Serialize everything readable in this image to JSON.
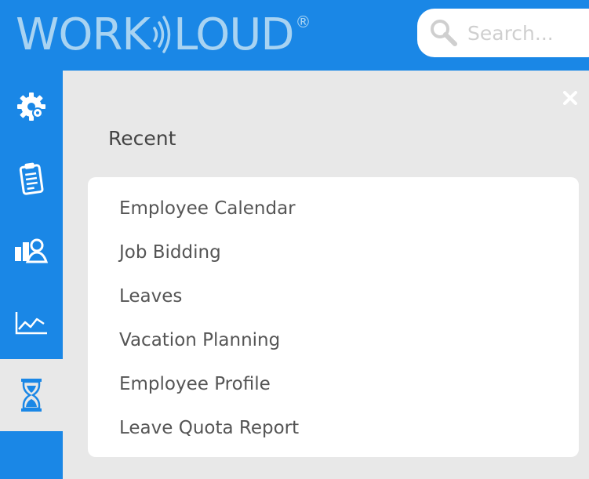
{
  "header": {
    "logo_text_left": "WORK",
    "logo_text_right": "LOUD",
    "logo_registered": "®",
    "logo_color": "#a8d3f2",
    "brand_color": "#1a87e6"
  },
  "search": {
    "placeholder": "Search...",
    "value": "",
    "icon": "search-icon"
  },
  "sidebar": {
    "items": [
      {
        "name": "settings",
        "icon": "gear-icon"
      },
      {
        "name": "clipboard",
        "icon": "clipboard-icon"
      },
      {
        "name": "people",
        "icon": "people-icon"
      },
      {
        "name": "reports",
        "icon": "line-chart-icon"
      },
      {
        "name": "recent",
        "icon": "hourglass-icon",
        "active": true
      }
    ]
  },
  "main": {
    "close_icon": "close-icon",
    "section_title": "Recent",
    "recent_items": [
      "Employee Calendar",
      "Job Bidding",
      "Leaves",
      "Vacation Planning",
      "Employee Profile",
      "Leave Quota Report"
    ]
  }
}
